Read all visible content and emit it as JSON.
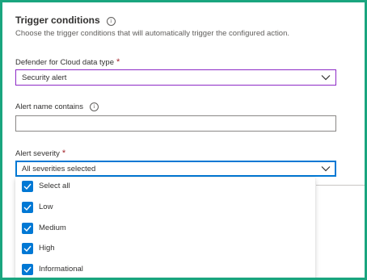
{
  "section": {
    "title": "Trigger conditions",
    "description": "Choose the trigger conditions that will automatically trigger the configured action."
  },
  "fields": {
    "data_type": {
      "label": "Defender for Cloud data type",
      "required": "*",
      "value": "Security alert"
    },
    "alert_name": {
      "label": "Alert name contains",
      "value": ""
    },
    "severity": {
      "label": "Alert severity",
      "required": "*",
      "value": "All severities selected",
      "options": [
        {
          "label": "Select all",
          "checked": true
        },
        {
          "label": "Low",
          "checked": true
        },
        {
          "label": "Medium",
          "checked": true
        },
        {
          "label": "High",
          "checked": true
        },
        {
          "label": "Informational",
          "checked": true
        }
      ]
    }
  },
  "colors": {
    "accent": "#0078d4",
    "frame": "#1aa57f",
    "required": "#a4262c",
    "focus_purple": "#8d2ac6"
  },
  "icons": {
    "info": "info-icon",
    "chevron": "chevron-down-icon",
    "check": "checkmark-icon"
  }
}
